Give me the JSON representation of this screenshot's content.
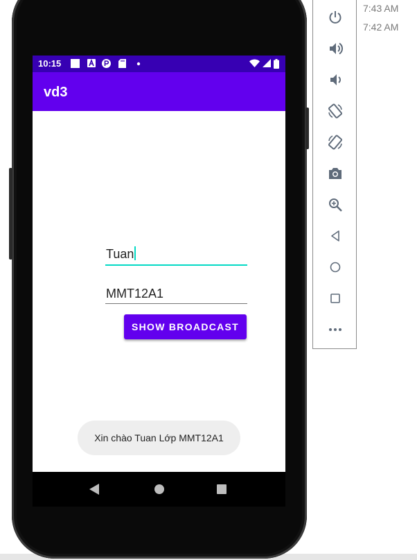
{
  "statusbar": {
    "time": "10:15",
    "icons": [
      "notification-square-icon",
      "a-box-icon",
      "p-circle-icon",
      "sd-card-icon",
      "dot-icon",
      "wifi-icon",
      "signal-icon",
      "battery-icon"
    ]
  },
  "appbar": {
    "title": "vd3"
  },
  "form": {
    "name_value": "Tuan",
    "class_value": "MMT12A1",
    "button_label": "SHOW BROADCAST"
  },
  "toast": {
    "message": "Xin chào Tuan Lớp MMT12A1"
  },
  "emulator_toolbar": {
    "buttons": [
      "power-icon",
      "volume-up-icon",
      "volume-down-icon",
      "rotate-left-icon",
      "rotate-right-icon",
      "camera-icon",
      "zoom-icon",
      "back-icon",
      "home-icon",
      "overview-icon",
      "more-icon"
    ]
  },
  "timestamps": [
    "7:43 AM",
    "7:42 AM"
  ],
  "colors": {
    "statusbar": "#3700b3",
    "primary": "#6200ee",
    "accent": "#03dac5",
    "toolbar_icon": "#5f6b7a"
  }
}
